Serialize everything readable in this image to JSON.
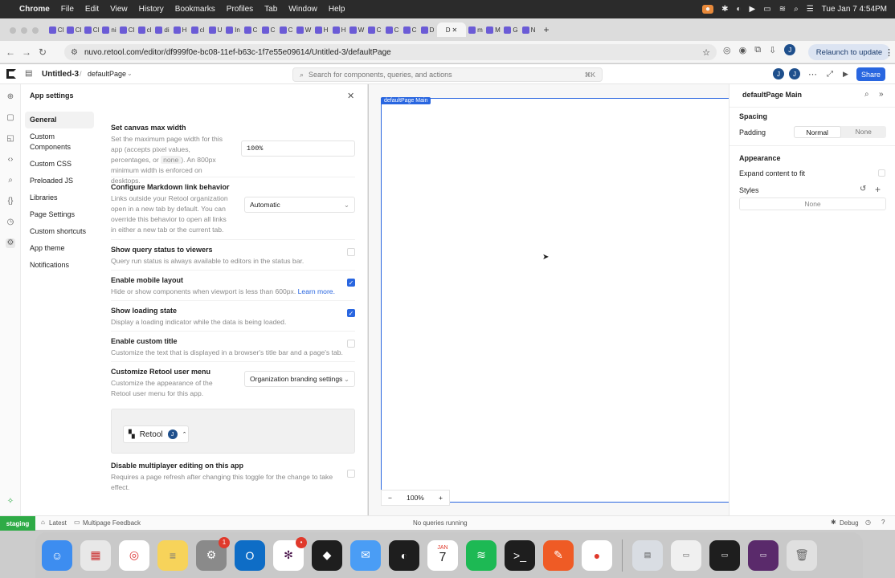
{
  "menubar": {
    "apple": "",
    "app": "Chrome",
    "items": [
      "File",
      "Edit",
      "View",
      "History",
      "Bookmarks",
      "Profiles",
      "Tab",
      "Window",
      "Help"
    ],
    "clock": "Tue Jan 7  4:54PM"
  },
  "tabs": [
    {
      "label": "Cl"
    },
    {
      "label": "Cl"
    },
    {
      "label": "Cl"
    },
    {
      "label": "ni"
    },
    {
      "label": "Cl"
    },
    {
      "label": "cl"
    },
    {
      "label": "di"
    },
    {
      "label": "H"
    },
    {
      "label": "cl"
    },
    {
      "label": "U"
    },
    {
      "label": "In"
    },
    {
      "label": "C"
    },
    {
      "label": "C"
    },
    {
      "label": "C"
    },
    {
      "label": "W"
    },
    {
      "label": "H"
    },
    {
      "label": "H"
    },
    {
      "label": "W"
    },
    {
      "label": "C"
    },
    {
      "label": "C"
    },
    {
      "label": "C"
    },
    {
      "label": "D"
    },
    {
      "label": "D"
    },
    {
      "label": "m"
    },
    {
      "label": "M"
    },
    {
      "label": "G"
    },
    {
      "label": "N"
    }
  ],
  "active_tab": {
    "label": "D"
  },
  "browser": {
    "url": "nuvo.retool.com/editor/df999f0e-bc08-11ef-b63c-1f7e55e09614/Untitled-3/defaultPage",
    "relaunch": "Relaunch to update"
  },
  "editor": {
    "app_name": "Untitled-3",
    "separator": "/",
    "page": "defaultPage",
    "search_placeholder": "Search for components, queries, and actions",
    "search_shortcut": "⌘K",
    "avatar1": "J",
    "avatar2": "J",
    "share": "Share"
  },
  "settings": {
    "title": "App settings",
    "nav": [
      "General",
      "Custom Components",
      "Custom CSS",
      "Preloaded JS",
      "Libraries",
      "Page Settings",
      "Custom shortcuts",
      "App theme",
      "Notifications"
    ],
    "canvas_width": {
      "title": "Set canvas max width",
      "desc_a": "Set the maximum page width for this app (accepts pixel values, percentages, or",
      "code": "none",
      "desc_b": "). An 800px minimum width is enforced on desktops.",
      "value": "100%"
    },
    "markdown": {
      "title": "Configure Markdown link behavior",
      "desc": "Links outside your Retool organization open in a new tab by default. You can override this behavior to open all links in either a new tab or the current tab.",
      "value": "Automatic"
    },
    "query_status": {
      "title": "Show query status to viewers",
      "desc": "Query run status is always available to editors in the status bar.",
      "checked": false
    },
    "mobile": {
      "title": "Enable mobile layout",
      "desc": "Hide or show components when viewport is less than 600px.",
      "link": "Learn more.",
      "checked": true
    },
    "loading": {
      "title": "Show loading state",
      "desc": "Display a loading indicator while the data is being loaded.",
      "checked": true
    },
    "custom_title": {
      "title": "Enable custom title",
      "desc": "Customize the text that is displayed in a browser's title bar and a page's tab.",
      "checked": false
    },
    "user_menu": {
      "title": "Customize Retool user menu",
      "desc": "Customize the appearance of the Retool user menu for this app.",
      "value": "Organization branding settings",
      "preview_brand": "Retool",
      "preview_avatar": "J"
    },
    "multiplayer": {
      "title": "Disable multiplayer editing on this app",
      "desc": "Requires a page refresh after changing this toggle for the change to take effect.",
      "checked": false
    }
  },
  "canvas": {
    "frame_label": "defaultPage Main",
    "zoom": "100%",
    "minus": "−",
    "plus": "+"
  },
  "inspector": {
    "title": "defaultPage Main",
    "spacing": "Spacing",
    "padding": "Padding",
    "padding_options": [
      "Normal",
      "None"
    ],
    "padding_selected": "Normal",
    "appearance": "Appearance",
    "expand": "Expand content to fit",
    "styles": "Styles",
    "styles_value": "None"
  },
  "statusbar": {
    "env": "staging",
    "latest": "Latest",
    "feedback": "Multipage Feedback",
    "queries": "No queries running",
    "debug": "Debug"
  },
  "dock": {
    "apps": [
      {
        "name": "Finder",
        "color": "#3d8df0"
      },
      {
        "name": "Launchpad",
        "color": "#e8e8e8"
      },
      {
        "name": "Chrome",
        "color": "#ffffff"
      },
      {
        "name": "Notes",
        "color": "#f7d35a"
      },
      {
        "name": "System Settings",
        "color": "#8a8a8a",
        "badge": "1"
      },
      {
        "name": "Outlook",
        "color": "#0e6dc6"
      },
      {
        "name": "Slack",
        "color": "#ffffff",
        "badge": "•"
      },
      {
        "name": "Cursor",
        "color": "#1e1e1e"
      },
      {
        "name": "Mail",
        "color": "#4a9df5"
      },
      {
        "name": "Linear",
        "color": "#1e1e1e"
      },
      {
        "name": "Calendar",
        "color": "#ffffff",
        "month": "JAN",
        "day": "7"
      },
      {
        "name": "Spotify",
        "color": "#1db954"
      },
      {
        "name": "Terminal",
        "color": "#1e1e1e"
      },
      {
        "name": "Postman",
        "color": "#ef5b25"
      },
      {
        "name": "Pop",
        "color": "#ffffff"
      }
    ]
  }
}
